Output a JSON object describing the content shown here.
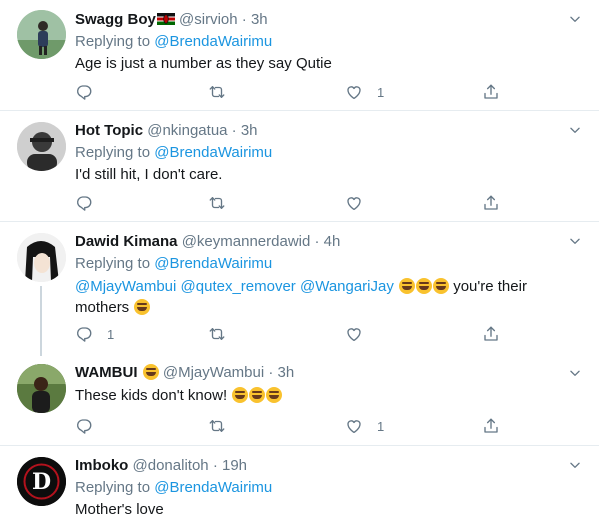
{
  "tweets": [
    {
      "name": "Swagg Boy",
      "handle": "@sirvioh",
      "time": "3h",
      "replying_label": "Replying to",
      "replying_to": "@BrendaWairimu",
      "text": "Age is just a number as they say Qutie",
      "reply_count": "",
      "like_count": "1"
    },
    {
      "name": "Hot Topic",
      "handle": "@nkingatua",
      "time": "3h",
      "replying_label": "Replying to",
      "replying_to": "@BrendaWairimu",
      "text": "I'd still hit, I don't care.",
      "reply_count": "",
      "like_count": ""
    },
    {
      "name": "Dawid Kimana",
      "handle": "@keymannerdawid",
      "time": "4h",
      "replying_label": "Replying to",
      "replying_to": "@BrendaWairimu",
      "mentions": [
        "@MjayWambui",
        "@qutex_remover",
        "@WangariJay"
      ],
      "text_after": "you're their",
      "text_line2": "mothers",
      "reply_count": "1",
      "like_count": ""
    },
    {
      "name": "WAMBUI",
      "handle": "@MjayWambui",
      "time": "3h",
      "text": "These kids don't know!",
      "reply_count": "",
      "like_count": "1"
    },
    {
      "name": "Imboko",
      "handle": "@donalitoh",
      "time": "19h",
      "replying_label": "Replying to",
      "replying_to": "@BrendaWairimu",
      "text": "Mother's love"
    }
  ],
  "separator": "·",
  "icons": {
    "reply": "reply-icon",
    "retweet": "retweet-icon",
    "like": "heart-icon",
    "share": "share-icon",
    "more": "chevron-down-icon",
    "flag": "kenya-flag-icon",
    "laugh": "rofl-emoji-icon",
    "blowkiss": "kiss-emoji-icon",
    "joy": "joy-emoji-icon"
  },
  "colors": {
    "link": "#1b95e0",
    "muted": "#657786",
    "text": "#14171a",
    "border": "#e6ecf0"
  }
}
